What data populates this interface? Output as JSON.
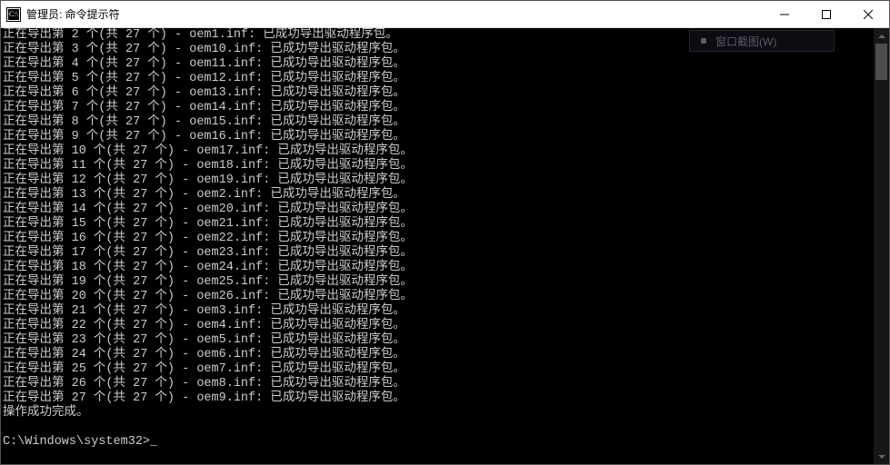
{
  "window": {
    "title": "管理员: 命令提示符"
  },
  "overlay": {
    "label": "窗口截图(W)"
  },
  "terminal": {
    "lines": [
      "正在导出第 2 个(共 27 个) - oem1.inf: 已成功导出驱动程序包。",
      "正在导出第 3 个(共 27 个) - oem10.inf: 已成功导出驱动程序包。",
      "正在导出第 4 个(共 27 个) - oem11.inf: 已成功导出驱动程序包。",
      "正在导出第 5 个(共 27 个) - oem12.inf: 已成功导出驱动程序包。",
      "正在导出第 6 个(共 27 个) - oem13.inf: 已成功导出驱动程序包。",
      "正在导出第 7 个(共 27 个) - oem14.inf: 已成功导出驱动程序包。",
      "正在导出第 8 个(共 27 个) - oem15.inf: 已成功导出驱动程序包。",
      "正在导出第 9 个(共 27 个) - oem16.inf: 已成功导出驱动程序包。",
      "正在导出第 10 个(共 27 个) - oem17.inf: 已成功导出驱动程序包。",
      "正在导出第 11 个(共 27 个) - oem18.inf: 已成功导出驱动程序包。",
      "正在导出第 12 个(共 27 个) - oem19.inf: 已成功导出驱动程序包。",
      "正在导出第 13 个(共 27 个) - oem2.inf: 已成功导出驱动程序包。",
      "正在导出第 14 个(共 27 个) - oem20.inf: 已成功导出驱动程序包。",
      "正在导出第 15 个(共 27 个) - oem21.inf: 已成功导出驱动程序包。",
      "正在导出第 16 个(共 27 个) - oem22.inf: 已成功导出驱动程序包。",
      "正在导出第 17 个(共 27 个) - oem23.inf: 已成功导出驱动程序包。",
      "正在导出第 18 个(共 27 个) - oem24.inf: 已成功导出驱动程序包。",
      "正在导出第 19 个(共 27 个) - oem25.inf: 已成功导出驱动程序包。",
      "正在导出第 20 个(共 27 个) - oem26.inf: 已成功导出驱动程序包。",
      "正在导出第 21 个(共 27 个) - oem3.inf: 已成功导出驱动程序包。",
      "正在导出第 22 个(共 27 个) - oem4.inf: 已成功导出驱动程序包。",
      "正在导出第 23 个(共 27 个) - oem5.inf: 已成功导出驱动程序包。",
      "正在导出第 24 个(共 27 个) - oem6.inf: 已成功导出驱动程序包。",
      "正在导出第 25 个(共 27 个) - oem7.inf: 已成功导出驱动程序包。",
      "正在导出第 26 个(共 27 个) - oem8.inf: 已成功导出驱动程序包。",
      "正在导出第 27 个(共 27 个) - oem9.inf: 已成功导出驱动程序包。",
      "操作成功完成。",
      "",
      "C:\\Windows\\system32>_"
    ]
  }
}
